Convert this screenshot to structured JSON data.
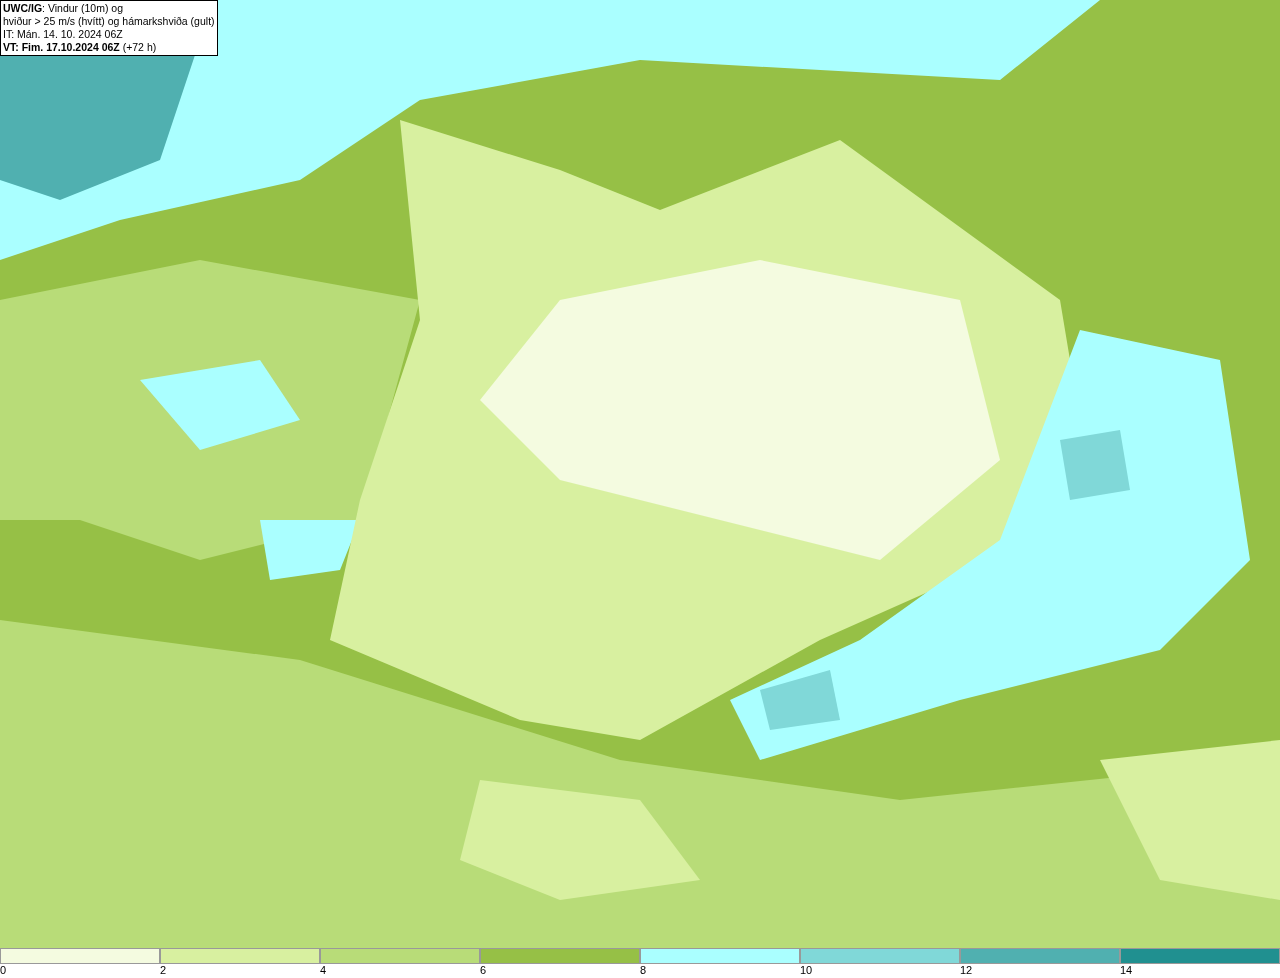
{
  "title_box": {
    "lines": [
      "**UWC/IG**: Vindur (10m) og",
      "hviður > 25 m/s (hvítt) og hámarkshviða (gult)",
      "IT: Mán. 14. 10. 2024 06Z",
      "**VT: Fim. 17.10.2024 06Z** (+72 h)"
    ]
  },
  "legend": {
    "bins": [
      {
        "label": "0",
        "color": "#f4fbe0"
      },
      {
        "label": "2",
        "color": "#d8f0a0"
      },
      {
        "label": "4",
        "color": "#b8dc78"
      },
      {
        "label": "6",
        "color": "#96c046"
      },
      {
        "label": "8",
        "color": "#aaffff"
      },
      {
        "label": "10",
        "color": "#80d8d8"
      },
      {
        "label": "12",
        "color": "#50b0b0"
      },
      {
        "label": "14",
        "color": "#209090"
      }
    ]
  }
}
